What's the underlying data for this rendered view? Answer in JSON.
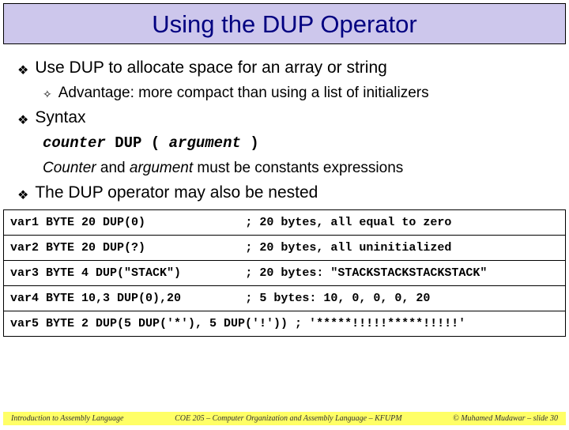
{
  "title": "Using the DUP Operator",
  "bullets": {
    "b1": "Use DUP to allocate space for an array or string",
    "b1a": "Advantage: more compact than using a list of initializers",
    "b2": "Syntax",
    "syntax_counter": "counter",
    "syntax_dup": " DUP ( ",
    "syntax_arg": "argument",
    "syntax_close": " )",
    "note_counter": "Counter",
    "note_and": " and ",
    "note_argument": "argument",
    "note_rest": " must be constants expressions",
    "b3": "The DUP operator may also be nested"
  },
  "code": {
    "r1c1": "var1 BYTE 20 DUP(0)",
    "r1c2": "; 20 bytes, all equal to zero",
    "r2c1": "var2 BYTE 20 DUP(?)",
    "r2c2": "; 20 bytes, all uninitialized",
    "r3c1": "var3 BYTE 4 DUP(\"STACK\")",
    "r3c2": "; 20 bytes: \"STACKSTACKSTACKSTACK\"",
    "r4c1": "var4 BYTE 10,3 DUP(0),20",
    "r4c2": "; 5 bytes: 10, 0, 0, 0, 20",
    "r5": "var5 BYTE 2 DUP(5 DUP('*'), 5 DUP('!')) ; '*****!!!!!*****!!!!!'"
  },
  "footer": {
    "left": "Introduction to Assembly Language",
    "center": "COE 205 – Computer Organization and Assembly Language – KFUPM",
    "right": "© Muhamed Mudawar – slide 30"
  }
}
